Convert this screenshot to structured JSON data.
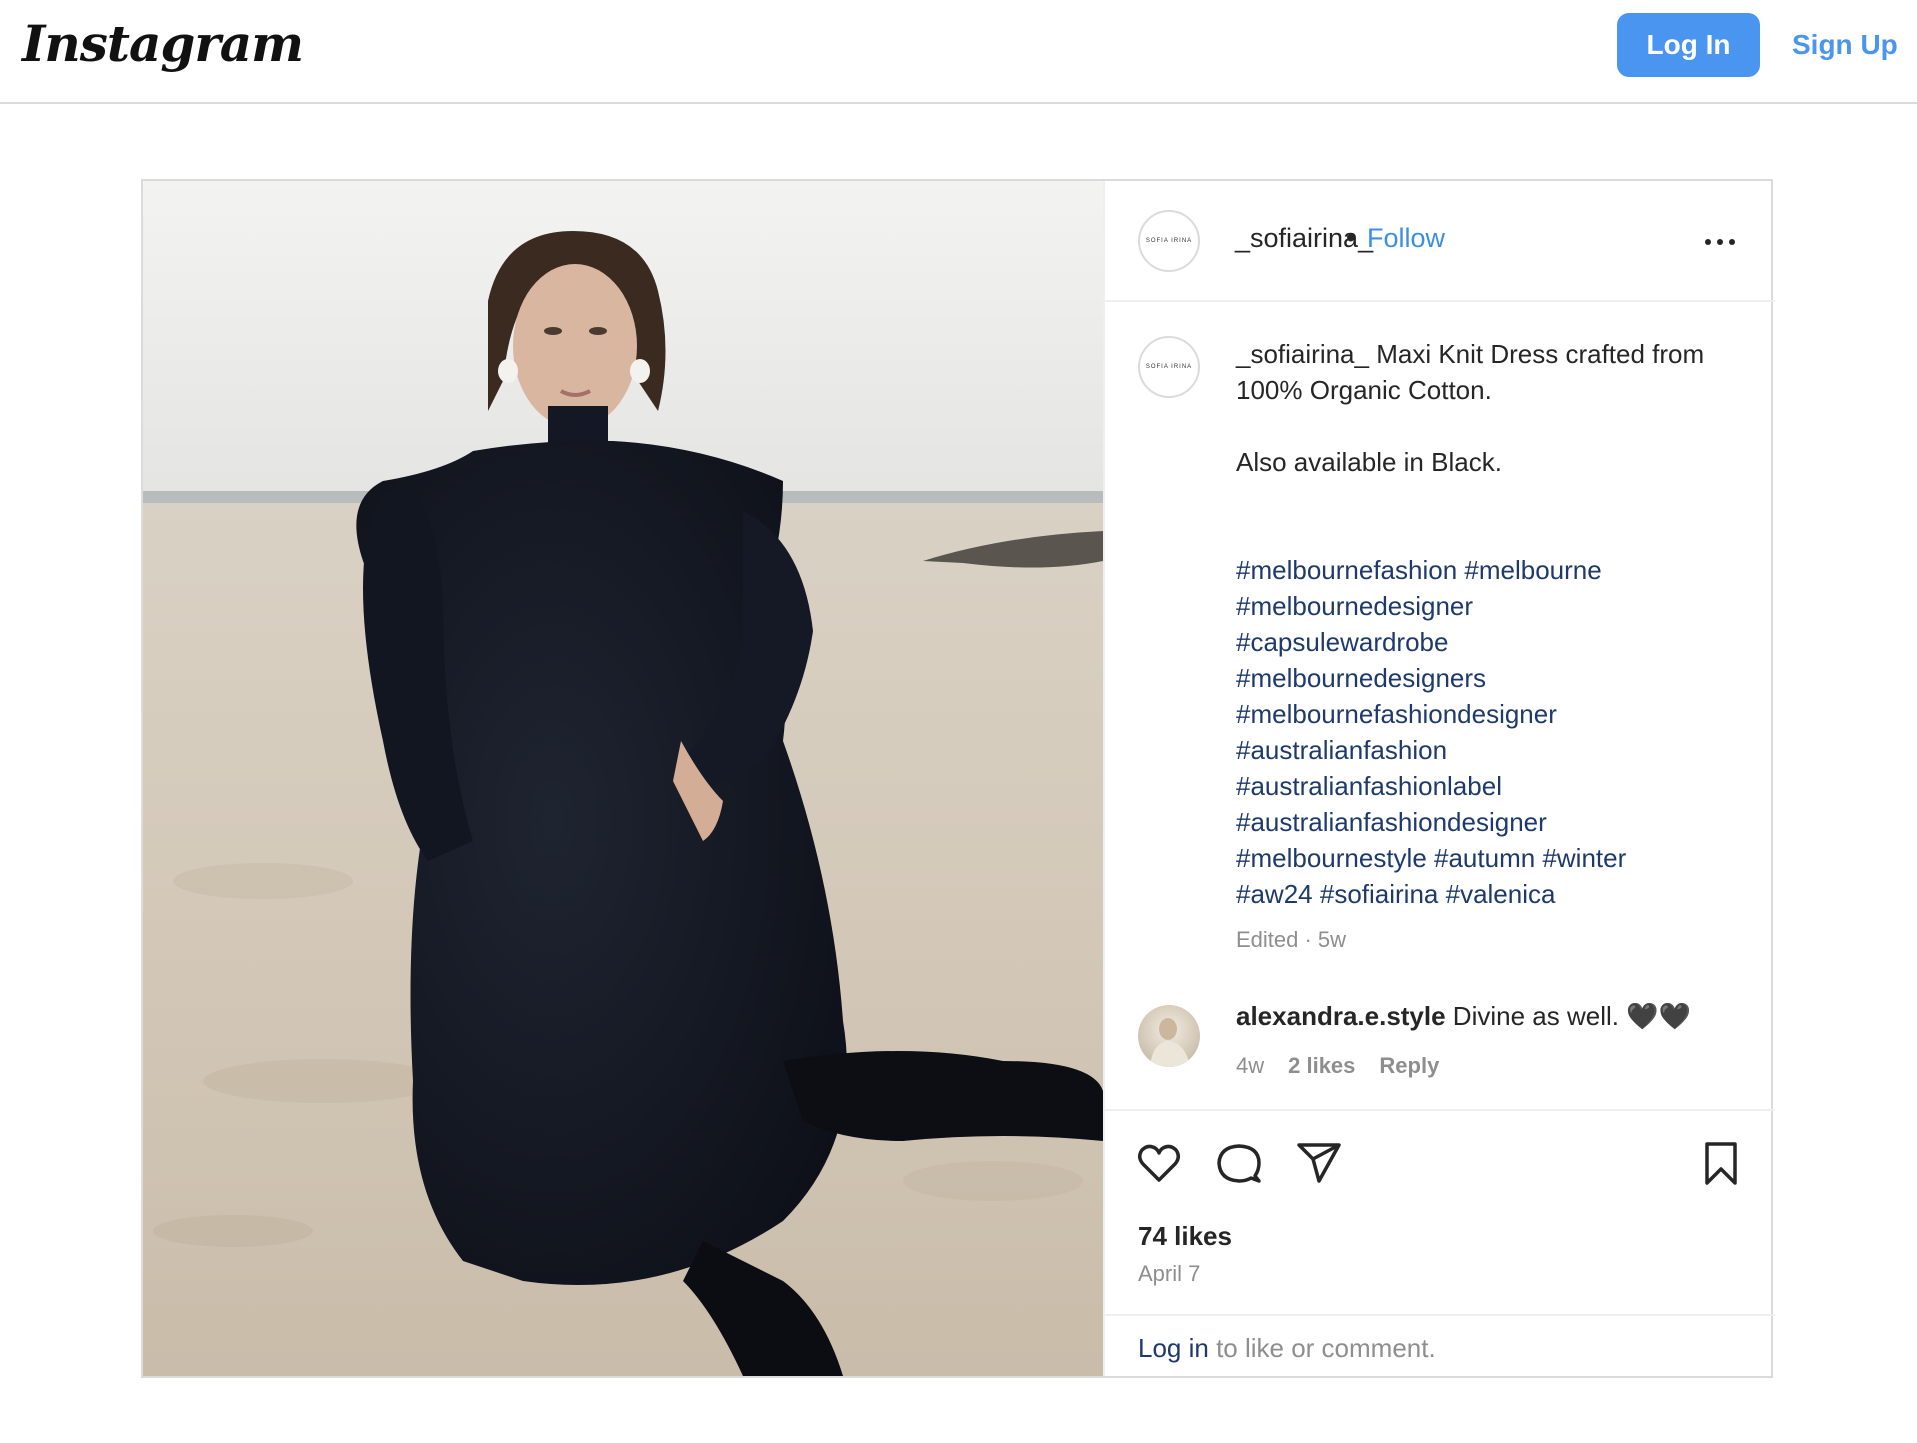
{
  "header": {
    "logo_text": "Instagram",
    "login_label": "Log In",
    "signup_label": "Sign Up",
    "accent_color": "#4a95f0"
  },
  "post": {
    "author": {
      "username": "_sofiairina_",
      "avatar_text": "SOFIA IRINA",
      "follow_label": "Follow",
      "separator": "•"
    },
    "image": {
      "alt": "Model in black knit maxi dress sitting on beach sand"
    },
    "caption": {
      "username": "_sofiairina_",
      "text_line1": " Maxi Knit Dress crafted from 100% Organic Cotton.",
      "text_line2": "Also available in Black.",
      "hashtags": [
        "#melbournefashion",
        "#melbourne",
        "#melbournedesigner",
        "#capsulewardrobe",
        "#melbournedesigners",
        "#melbournefashiondesigner",
        "#australianfashion",
        "#australianfashionlabel",
        "#australianfashiondesigner",
        "#melbournestyle",
        "#autumn",
        "#winter",
        "#aw24",
        "#sofiairina",
        "#valenica"
      ],
      "meta": "Edited · 5w"
    },
    "comment": {
      "username": "alexandra.e.style",
      "text": " Divine as well. 🖤🖤",
      "age": "4w",
      "likes": "2 likes",
      "reply_label": "Reply"
    },
    "actions": {
      "like_icon": "heart-icon",
      "comment_icon": "comment-icon",
      "share_icon": "send-icon",
      "save_icon": "bookmark-icon"
    },
    "likes": "74 likes",
    "date": "April 7",
    "login_prompt": {
      "link": "Log in",
      "rest": " to like or comment."
    }
  }
}
